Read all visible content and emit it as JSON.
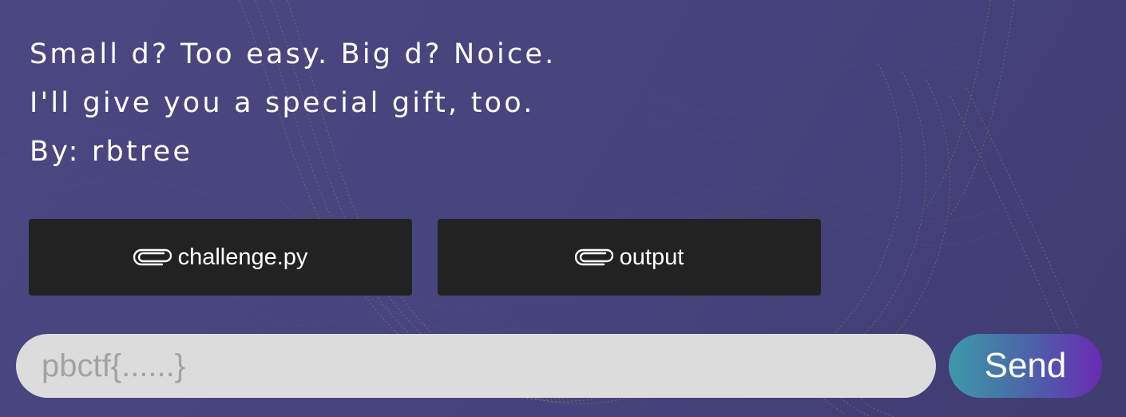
{
  "challenge": {
    "description_lines": [
      "Small d? Too easy. Big d? Noice.",
      "I'll give you a special gift, too.",
      "By: rbtree"
    ],
    "attachments": [
      {
        "label": "challenge.py",
        "icon": "paperclip-icon"
      },
      {
        "label": "output",
        "icon": "paperclip-icon"
      }
    ]
  },
  "flag_form": {
    "placeholder": "pbctf{......}",
    "value": "",
    "send_label": "Send"
  },
  "colors": {
    "background": "#48447e",
    "button_bg": "#222222",
    "input_bg": "#dcdcdc",
    "send_gradient_start": "#3d9aa8",
    "send_gradient_end": "#6a2ab4"
  }
}
